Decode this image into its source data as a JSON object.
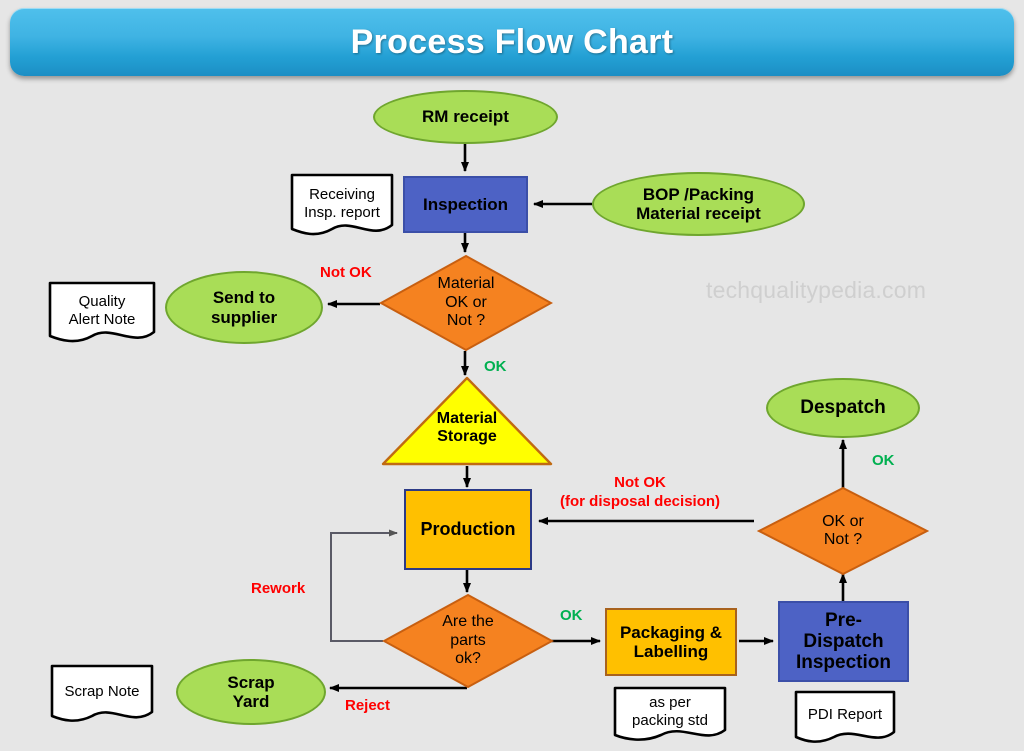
{
  "banner": {
    "title": "Process Flow Chart"
  },
  "watermark": {
    "text": "techqualitypedia.com"
  },
  "colors": {
    "background": "#e6e6e6",
    "banner_top": "#4fc0ec",
    "banner_bottom": "#1c8ec4",
    "terminator_green": "#a9dd57",
    "terminator_green_border": "#6fa62e",
    "process_blue": "#4d62c5",
    "process_amber": "#ffc000",
    "decision_orange": "#f58220",
    "storage_yellow": "#ffff00",
    "label_not_ok": "#ff0000",
    "label_ok": "#00b050"
  },
  "nodes": {
    "rm_receipt": {
      "label": "RM receipt",
      "shape": "ellipse"
    },
    "receiving_insp_report": {
      "label": "Receiving\nInsp. report",
      "shape": "document"
    },
    "inspection": {
      "label": "Inspection",
      "shape": "process"
    },
    "bop_packing": {
      "label": "BOP /Packing\nMaterial receipt",
      "shape": "ellipse"
    },
    "material_decision": {
      "label": "Material\nOK or\nNot ?",
      "shape": "decision"
    },
    "send_to_supplier": {
      "label": "Send to\nsupplier",
      "shape": "ellipse"
    },
    "quality_alert_note": {
      "label": "Quality\nAlert Note",
      "shape": "document"
    },
    "material_storage": {
      "label": "Material\nStorage",
      "shape": "triangle"
    },
    "production": {
      "label": "Production",
      "shape": "process"
    },
    "parts_ok_decision": {
      "label": "Are the\nparts\nok?",
      "shape": "decision"
    },
    "scrap_yard": {
      "label": "Scrap\nYard",
      "shape": "ellipse"
    },
    "scrap_note": {
      "label": "Scrap Note",
      "shape": "document"
    },
    "packaging_labelling": {
      "label": "Packaging &\nLabelling",
      "shape": "process"
    },
    "packing_std_note": {
      "label": "as per\npacking std",
      "shape": "document"
    },
    "pre_dispatch_inspection": {
      "label": "Pre-\nDispatch\nInspection",
      "shape": "process"
    },
    "pdi_report": {
      "label": "PDI Report",
      "shape": "document"
    },
    "ok_or_not_decision": {
      "label": "OK or\nNot ?",
      "shape": "decision"
    },
    "despatch": {
      "label": "Despatch",
      "shape": "ellipse"
    }
  },
  "edge_labels": {
    "material_not_ok": "Not OK",
    "material_ok": "OK",
    "disposal_not_ok": "Not OK\n(for disposal decision)",
    "rework": "Rework",
    "parts_ok": "OK",
    "reject": "Reject",
    "despatch_ok": "OK"
  },
  "chart_data": {
    "type": "diagram",
    "title": "Process Flow Chart",
    "nodes": [
      {
        "id": "rm_receipt",
        "label": "RM receipt",
        "shape": "ellipse",
        "fill": "#a9dd57"
      },
      {
        "id": "inspection",
        "label": "Inspection",
        "shape": "rectangle",
        "fill": "#4d62c5"
      },
      {
        "id": "bop_packing",
        "label": "BOP /Packing Material receipt",
        "shape": "ellipse",
        "fill": "#a9dd57"
      },
      {
        "id": "receiving_insp_report",
        "label": "Receiving Insp. report",
        "shape": "document",
        "fill": "#ffffff"
      },
      {
        "id": "material_decision",
        "label": "Material OK or Not ?",
        "shape": "diamond",
        "fill": "#f58220"
      },
      {
        "id": "send_to_supplier",
        "label": "Send to supplier",
        "shape": "ellipse",
        "fill": "#a9dd57"
      },
      {
        "id": "quality_alert_note",
        "label": "Quality Alert Note",
        "shape": "document",
        "fill": "#ffffff"
      },
      {
        "id": "material_storage",
        "label": "Material Storage",
        "shape": "triangle",
        "fill": "#ffff00"
      },
      {
        "id": "production",
        "label": "Production",
        "shape": "rectangle",
        "fill": "#ffc000"
      },
      {
        "id": "parts_ok_decision",
        "label": "Are the parts ok?",
        "shape": "diamond",
        "fill": "#f58220"
      },
      {
        "id": "scrap_yard",
        "label": "Scrap Yard",
        "shape": "ellipse",
        "fill": "#a9dd57"
      },
      {
        "id": "scrap_note",
        "label": "Scrap Note",
        "shape": "document",
        "fill": "#ffffff"
      },
      {
        "id": "packaging_labelling",
        "label": "Packaging & Labelling",
        "shape": "rectangle",
        "fill": "#ffc000"
      },
      {
        "id": "packing_std_note",
        "label": "as per packing std",
        "shape": "document",
        "fill": "#ffffff"
      },
      {
        "id": "pre_dispatch_inspection",
        "label": "Pre-Dispatch Inspection",
        "shape": "rectangle",
        "fill": "#4d62c5"
      },
      {
        "id": "pdi_report",
        "label": "PDI Report",
        "shape": "document",
        "fill": "#ffffff"
      },
      {
        "id": "ok_or_not_decision",
        "label": "OK or Not ?",
        "shape": "diamond",
        "fill": "#f58220"
      },
      {
        "id": "despatch",
        "label": "Despatch",
        "shape": "ellipse",
        "fill": "#a9dd57"
      }
    ],
    "edges": [
      {
        "from": "rm_receipt",
        "to": "inspection",
        "label": ""
      },
      {
        "from": "bop_packing",
        "to": "inspection",
        "label": ""
      },
      {
        "from": "inspection",
        "to": "material_decision",
        "label": ""
      },
      {
        "from": "material_decision",
        "to": "send_to_supplier",
        "label": "Not OK"
      },
      {
        "from": "material_decision",
        "to": "material_storage",
        "label": "OK"
      },
      {
        "from": "material_storage",
        "to": "production",
        "label": ""
      },
      {
        "from": "production",
        "to": "parts_ok_decision",
        "label": ""
      },
      {
        "from": "parts_ok_decision",
        "to": "packaging_labelling",
        "label": "OK"
      },
      {
        "from": "parts_ok_decision",
        "to": "scrap_yard",
        "label": "Reject"
      },
      {
        "from": "parts_ok_decision",
        "to": "production",
        "label": "Rework"
      },
      {
        "from": "packaging_labelling",
        "to": "pre_dispatch_inspection",
        "label": ""
      },
      {
        "from": "pre_dispatch_inspection",
        "to": "ok_or_not_decision",
        "label": ""
      },
      {
        "from": "ok_or_not_decision",
        "to": "despatch",
        "label": "OK"
      },
      {
        "from": "ok_or_not_decision",
        "to": "production",
        "label": "Not OK (for disposal decision)"
      }
    ]
  }
}
